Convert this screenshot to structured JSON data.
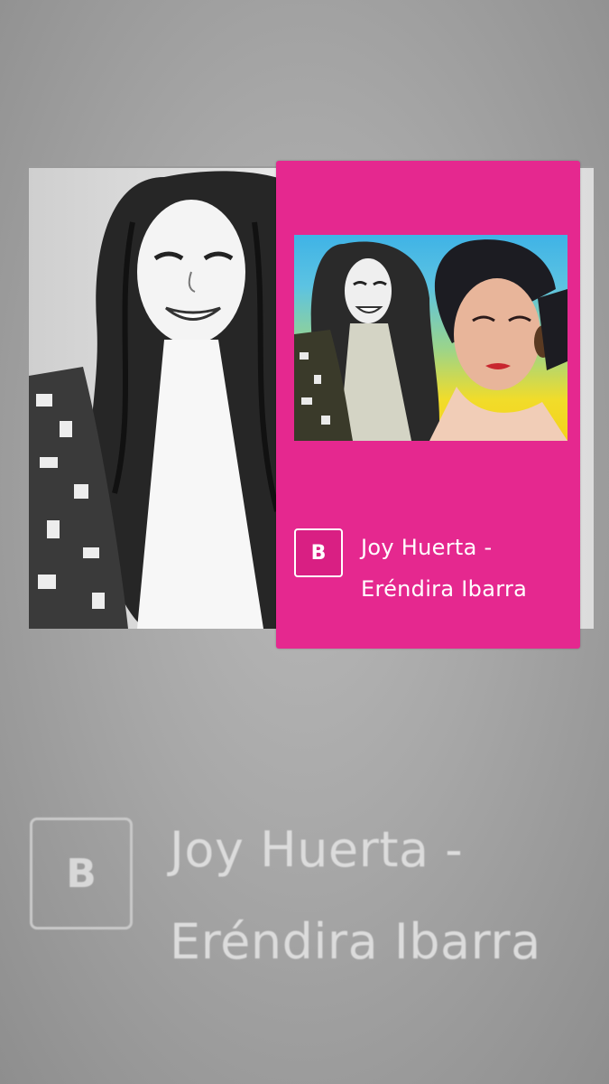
{
  "story": {
    "link_card": {
      "logo_letter": "B",
      "title": "Joy Huerta - Eréndira Ibarra",
      "accent_color": "#e5288f"
    },
    "background_caption": {
      "logo_letter": "B",
      "title": "Joy Huerta - Eréndira Ibarra"
    },
    "icons": {
      "card_logo": "brand-b-icon",
      "background_logo": "brand-b-icon"
    }
  }
}
